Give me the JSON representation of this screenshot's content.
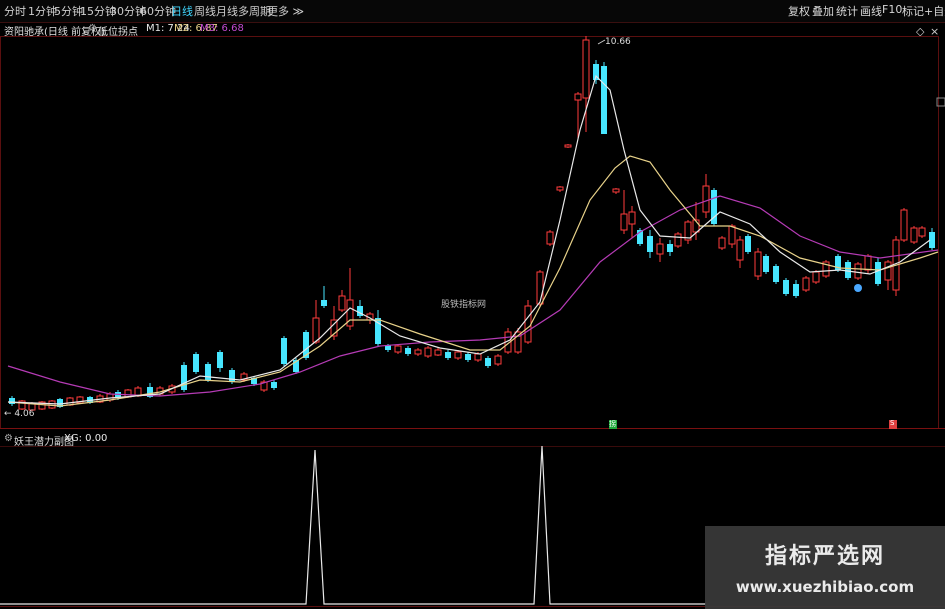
{
  "toolbar": {
    "timeframes": [
      "分时",
      "1分钟",
      "5分钟",
      "15分钟",
      "30分钟",
      "60分钟",
      "日线",
      "周线",
      "月线",
      "多周期",
      "更多 ≫"
    ],
    "active_timeframe": "日线",
    "right_buttons": [
      "复权",
      "叠加",
      "统计",
      "画线",
      "F10",
      "标记",
      "+自选"
    ]
  },
  "info_bar": {
    "indicator_name": "资阳驰承(日线 前复权)",
    "formula_name": "低位拐点",
    "m1": "M1: 7.24",
    "m2": "M2: 6.87",
    "m3": "M3: 6.68"
  },
  "main_chart": {
    "high_label": "10.66",
    "low_label": "← 4.06",
    "center_text": "股铁指标网",
    "marker_left": "拐",
    "marker_right": "S"
  },
  "sub_chart": {
    "label": "妖王潜力副图",
    "value": "XG: 0.00"
  },
  "watermark": {
    "title": "指标严选网",
    "url": "www.xuezhibiao.com"
  },
  "colors": {
    "up": "#ff3c3c",
    "down": "#47e6ff",
    "ma_white": "#e8e8e8",
    "ma_yellow": "#e8d28a",
    "ma_purple": "#b53bb5",
    "grid": "#5b0f0f"
  }
}
